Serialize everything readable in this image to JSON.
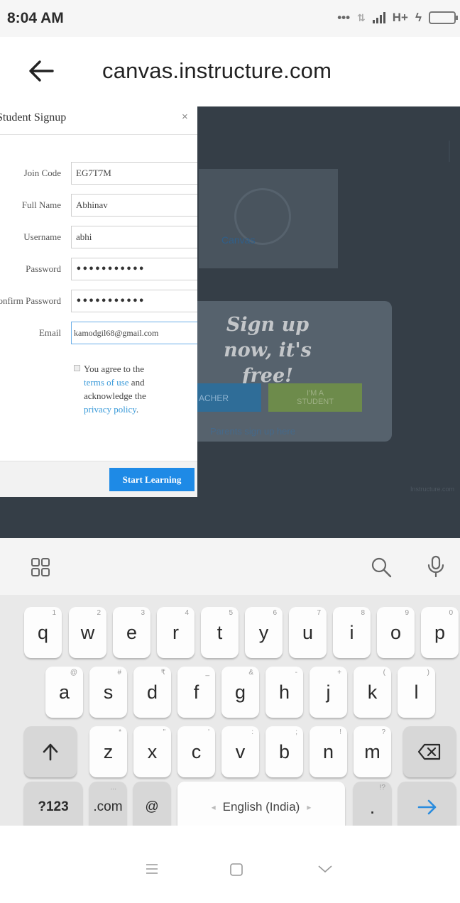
{
  "status_bar": {
    "time": "8:04 AM",
    "network_type": "H+"
  },
  "browser": {
    "url": "canvas.instructure.com"
  },
  "page_background": {
    "headline": "Sign up now, it's free!",
    "teacher_button": "ACHER",
    "student_button_line1": "I'M A",
    "student_button_line2": "STUDENT",
    "parents_link": "Parents sign up here",
    "banner_text": "Canvas",
    "corner_text": "Instructure.com"
  },
  "signup_modal": {
    "title": "Student Signup",
    "close_symbol": "×",
    "fields": {
      "join_code": {
        "label": "Join Code",
        "value": "EG7T7M"
      },
      "full_name": {
        "label": "Full Name",
        "value": "Abhinav"
      },
      "username": {
        "label": "Username",
        "value": "abhi"
      },
      "password": {
        "label": "Password",
        "value": "•••••••••••"
      },
      "confirm_password": {
        "label": "Confirm Password",
        "value": "•••••••••••"
      },
      "email": {
        "label": "Email",
        "value": "kamodgil68@gmail.com"
      }
    },
    "terms": {
      "prefix": "You agree to the ",
      "terms_link": "terms of use",
      "middle": " and acknowledge the ",
      "privacy_link": "privacy policy",
      "suffix": "."
    },
    "submit_label": "Start Learning"
  },
  "keyboard": {
    "rows": [
      [
        {
          "label": "q",
          "hint": "1"
        },
        {
          "label": "w",
          "hint": "2"
        },
        {
          "label": "e",
          "hint": "3"
        },
        {
          "label": "r",
          "hint": "4"
        },
        {
          "label": "t",
          "hint": "5"
        },
        {
          "label": "y",
          "hint": "6"
        },
        {
          "label": "u",
          "hint": "7"
        },
        {
          "label": "i",
          "hint": "8"
        },
        {
          "label": "o",
          "hint": "9"
        },
        {
          "label": "p",
          "hint": "0"
        }
      ],
      [
        {
          "label": "a",
          "hint": "@"
        },
        {
          "label": "s",
          "hint": "#"
        },
        {
          "label": "d",
          "hint": "₹"
        },
        {
          "label": "f",
          "hint": "_"
        },
        {
          "label": "g",
          "hint": "&"
        },
        {
          "label": "h",
          "hint": "-"
        },
        {
          "label": "j",
          "hint": "+"
        },
        {
          "label": "k",
          "hint": "("
        },
        {
          "label": "l",
          "hint": ")"
        }
      ],
      [
        {
          "label": "z",
          "hint": "*"
        },
        {
          "label": "x",
          "hint": "\""
        },
        {
          "label": "c",
          "hint": "'"
        },
        {
          "label": "v",
          "hint": ":"
        },
        {
          "label": "b",
          "hint": ";"
        },
        {
          "label": "n",
          "hint": "!"
        },
        {
          "label": "m",
          "hint": "?"
        }
      ]
    ],
    "symbols_key": "?123",
    "com_key": ".com",
    "com_hint": "...",
    "at_key": "@",
    "space_label": "English (India)",
    "period_key": ".",
    "period_hint": "!?"
  }
}
